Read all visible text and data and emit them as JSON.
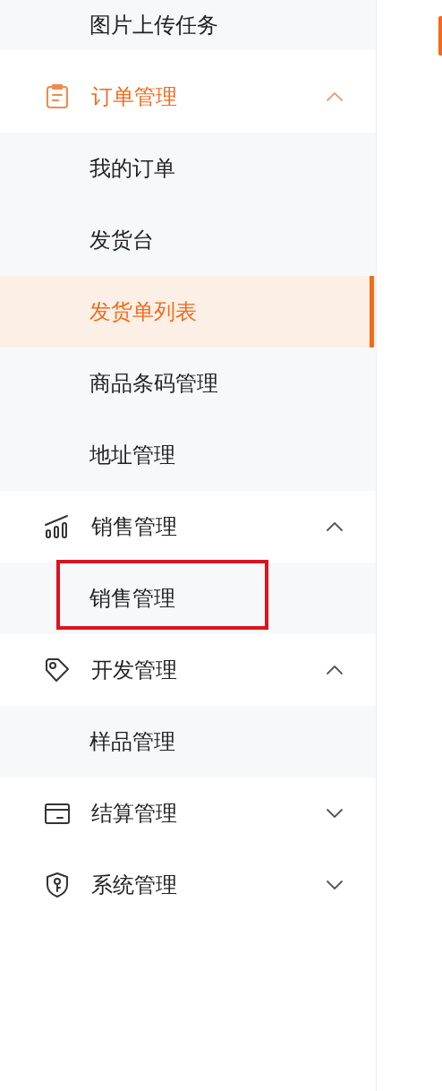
{
  "sidebar": {
    "leading_items": [
      {
        "label": "图片上传任务",
        "selected": false
      }
    ],
    "groups": [
      {
        "label": "订单管理",
        "active": true,
        "expanded": true,
        "children": [
          {
            "label": "我的订单",
            "selected": false,
            "annotated": false
          },
          {
            "label": "发货台",
            "selected": false,
            "annotated": false
          },
          {
            "label": "发货单列表",
            "selected": true,
            "annotated": false
          },
          {
            "label": "商品条码管理",
            "selected": false,
            "annotated": false
          },
          {
            "label": "地址管理",
            "selected": false,
            "annotated": false
          }
        ]
      },
      {
        "label": "销售管理",
        "active": false,
        "expanded": true,
        "children": [
          {
            "label": "销售管理",
            "selected": false,
            "annotated": true
          }
        ]
      },
      {
        "label": "开发管理",
        "active": false,
        "expanded": true,
        "children": [
          {
            "label": "样品管理",
            "selected": false,
            "annotated": false
          }
        ]
      },
      {
        "label": "结算管理",
        "active": false,
        "expanded": false
      },
      {
        "label": "系统管理",
        "active": false,
        "expanded": false
      }
    ]
  }
}
